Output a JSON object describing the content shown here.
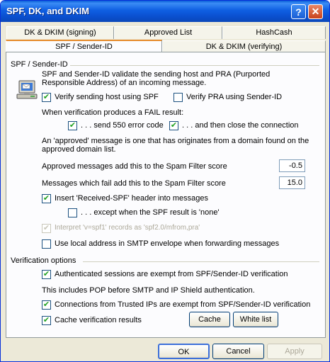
{
  "window": {
    "title": "SPF, DK, and DKIM",
    "help_glyph": "?",
    "close_glyph": "✕"
  },
  "tabs": {
    "back_row": [
      "DK & DKIM (signing)",
      "Approved List",
      "HashCash"
    ],
    "front_row": [
      "SPF / Sender-ID",
      "DK & DKIM (verifying)"
    ],
    "active": "SPF / Sender-ID"
  },
  "spf_group": {
    "label": "SPF / Sender-ID",
    "description_line1": "SPF and Sender-ID validate the sending host and PRA (Purported",
    "description_line2": "Responsible Address) of an incoming message.",
    "icon": "computer-mail-icon",
    "verify_spf": {
      "label": "Verify sending host using SPF",
      "checked": true
    },
    "verify_pra": {
      "label": "Verify PRA using Sender-ID",
      "checked": false
    },
    "fail_heading": "When verification produces a FAIL result:",
    "send_550": {
      "label": ". . . send 550 error code",
      "checked": true
    },
    "close_conn": {
      "label": ". . . and then close the connection",
      "checked": true
    },
    "approved_line1": "An 'approved' message is one that has originates from a domain found on the",
    "approved_line2": "approved domain list.",
    "approved_score": {
      "label": "Approved messages add this to the Spam Filter score",
      "value": "-0.5"
    },
    "fail_score": {
      "label": "Messages which fail add this to the Spam Filter score",
      "value": "15.0"
    },
    "insert_header": {
      "label": "Insert 'Received-SPF' header into messages",
      "checked": true
    },
    "except_none": {
      "label": ". . . except when the SPF result is 'none'",
      "checked": false
    },
    "interpret_spf1": {
      "label": "Interpret 'v=spf1' records as 'spf2.0/mfrom,pra'",
      "checked": true,
      "disabled": true
    },
    "use_local": {
      "label": "Use local address in SMTP envelope when forwarding messages",
      "checked": false
    }
  },
  "verification_group": {
    "label": "Verification options",
    "auth_exempt": {
      "label": "Authenticated sessions are exempt from SPF/Sender-ID verification",
      "checked": true
    },
    "info_text": "This includes POP before SMTP and IP Shield authentication.",
    "trusted_exempt": {
      "label": "Connections from Trusted IPs are exempt from SPF/Sender-ID verification",
      "checked": true
    },
    "cache_results": {
      "label": "Cache verification results",
      "checked": true
    },
    "cache_button": "Cache",
    "whitelist_button": "White list"
  },
  "footer": {
    "ok": "OK",
    "cancel": "Cancel",
    "apply": "Apply"
  },
  "check_glyph": "✔",
  "colors": {
    "titlebar": "#0a4fcf",
    "dialog_bg": "#ece9d8",
    "panel_bg": "#fcfcfe",
    "check": "#21a121"
  }
}
